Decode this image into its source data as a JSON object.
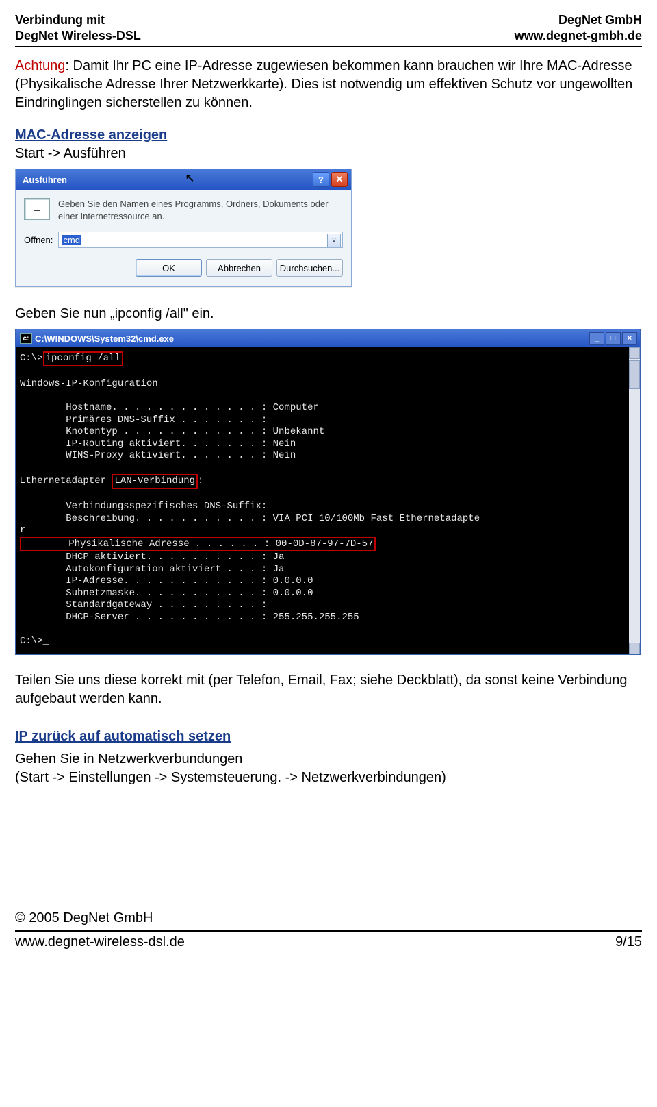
{
  "header": {
    "left1": "Verbindung mit",
    "left2": "DegNet Wireless-DSL",
    "right1": "DegNet GmbH",
    "right2": "www.degnet-gmbh.de"
  },
  "warning": {
    "label": "Achtung",
    "text": ": Damit Ihr PC eine IP-Adresse zugewiesen bekommen kann brauchen wir Ihre MAC-Adresse (Physikalische Adresse Ihrer Netzwerkkarte). Dies ist notwendig um effektiven Schutz vor ungewollten Eindringlingen sicherstellen zu können."
  },
  "section1": {
    "title": "MAC-Adresse anzeigen",
    "sub": "Start -> Ausführen"
  },
  "run": {
    "title": "Ausführen",
    "help_glyph": "?",
    "close_glyph": "✕",
    "desc": "Geben Sie den Namen eines Programms, Ordners, Dokuments oder einer Internetressource an.",
    "open_label": "Öffnen:",
    "value": "cmd",
    "dd_glyph": "∨",
    "ok": "OK",
    "cancel": "Abbrechen",
    "browse": "Durchsuchen..."
  },
  "mid_text": "Geben Sie nun „ipconfig /all\" ein.",
  "cmd": {
    "title": "C:\\WINDOWS\\System32\\cmd.exe",
    "min": "_",
    "max": "□",
    "close": "×",
    "l01": "C:\\>",
    "l01b": "ipconfig /all",
    "l02": "Windows-IP-Konfiguration",
    "l03": "        Hostname. . . . . . . . . . . . . : Computer",
    "l04": "        Primäres DNS-Suffix . . . . . . . :",
    "l05": "        Knotentyp . . . . . . . . . . . . : Unbekannt",
    "l06": "        IP-Routing aktiviert. . . . . . . : Nein",
    "l07": "        WINS-Proxy aktiviert. . . . . . . : Nein",
    "l08a": "Ethernetadapter ",
    "l08b": "LAN-Verbindung",
    "l08c": ":",
    "l09": "        Verbindungsspezifisches DNS-Suffix:",
    "l10": "        Beschreibung. . . . . . . . . . . : VIA PCI 10/100Mb Fast Ethernetadapte",
    "l10r": "r",
    "l11": "        Physikalische Adresse . . . . . . : 00-0D-87-97-7D-57",
    "l12": "        DHCP aktiviert. . . . . . . . . . : Ja",
    "l13": "        Autokonfiguration aktiviert . . . : Ja",
    "l14": "        IP-Adresse. . . . . . . . . . . . : 0.0.0.0",
    "l15": "        Subnetzmaske. . . . . . . . . . . : 0.0.0.0",
    "l16": "        Standardgateway . . . . . . . . . :",
    "l17": "        DHCP-Server . . . . . . . . . . . : 255.255.255.255",
    "l18": "C:\\>_"
  },
  "after_cmd": "Teilen Sie uns diese korrekt mit (per Telefon, Email, Fax; siehe Deckblatt), da sonst keine Verbindung aufgebaut werden kann.",
  "section2": {
    "title": "IP zurück auf automatisch setzen",
    "line1": "Gehen Sie in Netzwerkverbundungen",
    "line2": "(Start -> Einstellungen -> Systemsteuerung. -> Netzwerkverbindungen)"
  },
  "footer": {
    "copy": "© 2005 DegNet GmbH",
    "url": "www.degnet-wireless-dsl.de",
    "page": "9/15"
  }
}
